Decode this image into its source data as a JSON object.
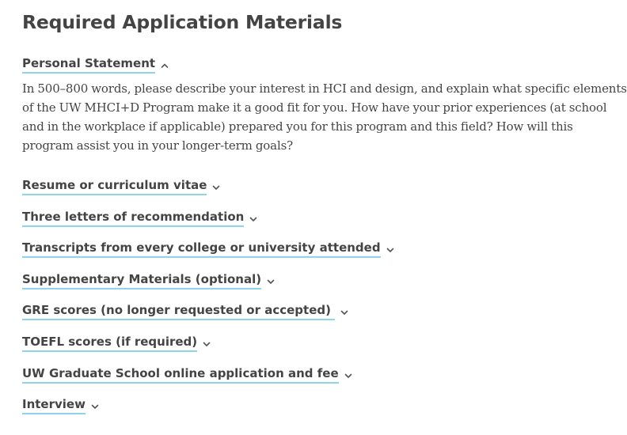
{
  "page": {
    "title": "Required Application Materials"
  },
  "sections": [
    {
      "label": "Personal Statement",
      "icon": "chevron-up-icon",
      "expanded": true,
      "content": "In 500–800 words, please describe your interest in HCI and design, and explain what specific elements of the UW MHCI+D Program make it a good fit for you. How have your prior experiences (at school and in the workplace if applicable) prepared you for this program and this field? How will this program assist you in your longer-term goals?"
    },
    {
      "label": "Resume or curriculum vitae",
      "icon": "chevron-down-icon",
      "expanded": false
    },
    {
      "label": "Three letters of recommendation",
      "icon": "chevron-down-icon",
      "expanded": false
    },
    {
      "label": "Transcripts from every college or university attended",
      "icon": "chevron-down-icon",
      "expanded": false
    },
    {
      "label": "Supplementary Materials (optional)",
      "icon": "chevron-down-icon",
      "expanded": false
    },
    {
      "label": "GRE scores (no longer requested or accepted) ",
      "icon": "chevron-down-icon",
      "expanded": false
    },
    {
      "label": "TOEFL scores (if required)",
      "icon": "chevron-down-icon",
      "expanded": false
    },
    {
      "label": "UW Graduate School online application and fee",
      "icon": "chevron-down-icon",
      "expanded": false
    },
    {
      "label": "Interview",
      "icon": "chevron-down-icon",
      "expanded": false
    }
  ],
  "colors": {
    "text": "#444444",
    "underline": "#8ed4ea",
    "background": "#ffffff"
  }
}
